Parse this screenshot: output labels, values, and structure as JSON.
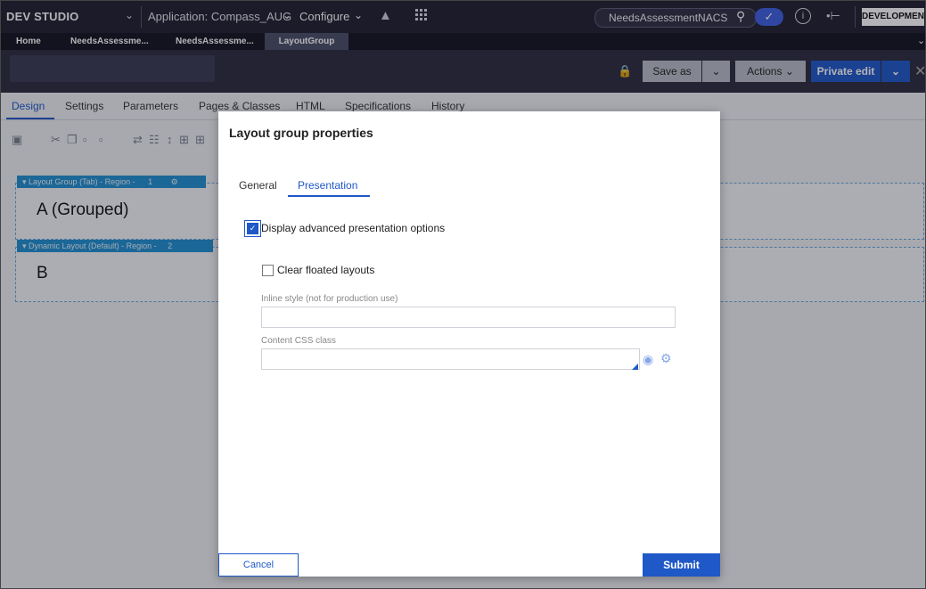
{
  "topbar": {
    "brand": "DEV STUDIO",
    "application": "Application: Compass_AUG",
    "configure": "Configure",
    "search_value": "NeedsAssessmentNACS",
    "environment": "DEVELOPMENT"
  },
  "tabs": [
    {
      "label": "Home"
    },
    {
      "label": "NeedsAssessme..."
    },
    {
      "label": "NeedsAssessme..."
    },
    {
      "label": "LayoutGroup"
    }
  ],
  "header": {
    "save_as": "Save as",
    "actions": "Actions",
    "private_edit": "Private edit"
  },
  "rule_tabs": [
    {
      "label": "Design"
    },
    {
      "label": "Settings"
    },
    {
      "label": "Parameters"
    },
    {
      "label": "Pages & Classes"
    },
    {
      "label": "HTML"
    },
    {
      "label": "Specifications"
    },
    {
      "label": "History"
    }
  ],
  "canvas": {
    "region1_label": "Layout Group (Tab) - Region -",
    "region1_number": "1",
    "region1_text": "A (Grouped)",
    "region2_label": "Dynamic Layout (Default) - Region -",
    "region2_number": "2",
    "region2_text": "B"
  },
  "modal": {
    "title": "Layout group properties",
    "tabs": [
      {
        "label": "General"
      },
      {
        "label": "Presentation"
      }
    ],
    "advanced_label": "Display advanced presentation options",
    "advanced_checked": true,
    "clear_floated_label": "Clear floated layouts",
    "clear_floated_checked": false,
    "inline_style_label": "Inline style (not for production use)",
    "inline_style_value": "",
    "content_css_label": "Content CSS class",
    "content_css_value": "",
    "cancel": "Cancel",
    "submit": "Submit"
  }
}
